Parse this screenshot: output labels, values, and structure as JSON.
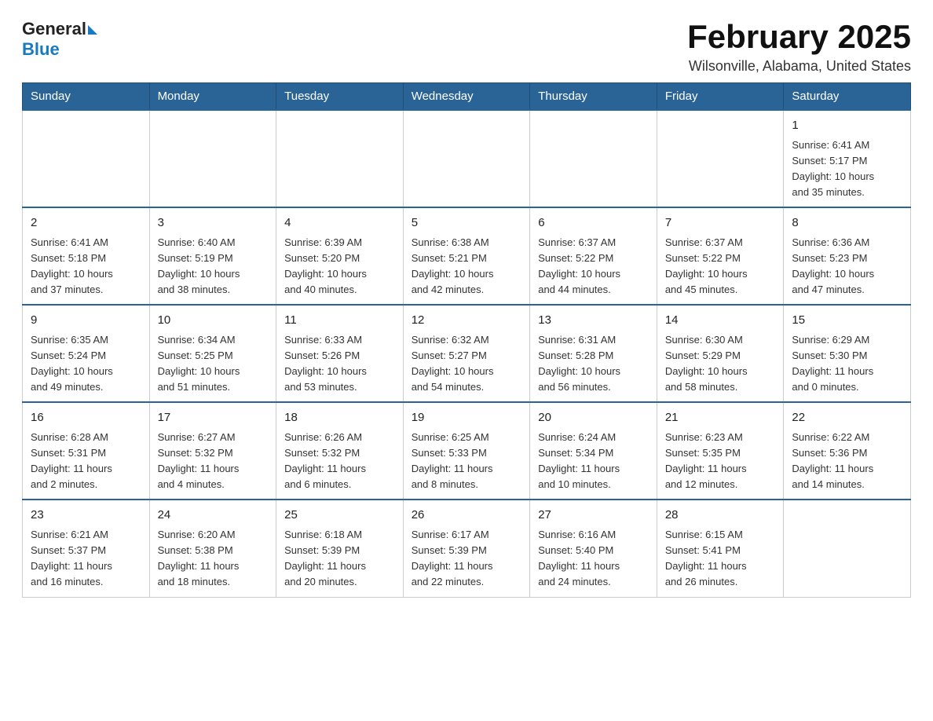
{
  "header": {
    "logo_general": "General",
    "logo_blue": "Blue",
    "month_year": "February 2025",
    "location": "Wilsonville, Alabama, United States"
  },
  "weekdays": [
    "Sunday",
    "Monday",
    "Tuesday",
    "Wednesday",
    "Thursday",
    "Friday",
    "Saturday"
  ],
  "weeks": [
    [
      {
        "day": "",
        "info": ""
      },
      {
        "day": "",
        "info": ""
      },
      {
        "day": "",
        "info": ""
      },
      {
        "day": "",
        "info": ""
      },
      {
        "day": "",
        "info": ""
      },
      {
        "day": "",
        "info": ""
      },
      {
        "day": "1",
        "info": "Sunrise: 6:41 AM\nSunset: 5:17 PM\nDaylight: 10 hours\nand 35 minutes."
      }
    ],
    [
      {
        "day": "2",
        "info": "Sunrise: 6:41 AM\nSunset: 5:18 PM\nDaylight: 10 hours\nand 37 minutes."
      },
      {
        "day": "3",
        "info": "Sunrise: 6:40 AM\nSunset: 5:19 PM\nDaylight: 10 hours\nand 38 minutes."
      },
      {
        "day": "4",
        "info": "Sunrise: 6:39 AM\nSunset: 5:20 PM\nDaylight: 10 hours\nand 40 minutes."
      },
      {
        "day": "5",
        "info": "Sunrise: 6:38 AM\nSunset: 5:21 PM\nDaylight: 10 hours\nand 42 minutes."
      },
      {
        "day": "6",
        "info": "Sunrise: 6:37 AM\nSunset: 5:22 PM\nDaylight: 10 hours\nand 44 minutes."
      },
      {
        "day": "7",
        "info": "Sunrise: 6:37 AM\nSunset: 5:22 PM\nDaylight: 10 hours\nand 45 minutes."
      },
      {
        "day": "8",
        "info": "Sunrise: 6:36 AM\nSunset: 5:23 PM\nDaylight: 10 hours\nand 47 minutes."
      }
    ],
    [
      {
        "day": "9",
        "info": "Sunrise: 6:35 AM\nSunset: 5:24 PM\nDaylight: 10 hours\nand 49 minutes."
      },
      {
        "day": "10",
        "info": "Sunrise: 6:34 AM\nSunset: 5:25 PM\nDaylight: 10 hours\nand 51 minutes."
      },
      {
        "day": "11",
        "info": "Sunrise: 6:33 AM\nSunset: 5:26 PM\nDaylight: 10 hours\nand 53 minutes."
      },
      {
        "day": "12",
        "info": "Sunrise: 6:32 AM\nSunset: 5:27 PM\nDaylight: 10 hours\nand 54 minutes."
      },
      {
        "day": "13",
        "info": "Sunrise: 6:31 AM\nSunset: 5:28 PM\nDaylight: 10 hours\nand 56 minutes."
      },
      {
        "day": "14",
        "info": "Sunrise: 6:30 AM\nSunset: 5:29 PM\nDaylight: 10 hours\nand 58 minutes."
      },
      {
        "day": "15",
        "info": "Sunrise: 6:29 AM\nSunset: 5:30 PM\nDaylight: 11 hours\nand 0 minutes."
      }
    ],
    [
      {
        "day": "16",
        "info": "Sunrise: 6:28 AM\nSunset: 5:31 PM\nDaylight: 11 hours\nand 2 minutes."
      },
      {
        "day": "17",
        "info": "Sunrise: 6:27 AM\nSunset: 5:32 PM\nDaylight: 11 hours\nand 4 minutes."
      },
      {
        "day": "18",
        "info": "Sunrise: 6:26 AM\nSunset: 5:32 PM\nDaylight: 11 hours\nand 6 minutes."
      },
      {
        "day": "19",
        "info": "Sunrise: 6:25 AM\nSunset: 5:33 PM\nDaylight: 11 hours\nand 8 minutes."
      },
      {
        "day": "20",
        "info": "Sunrise: 6:24 AM\nSunset: 5:34 PM\nDaylight: 11 hours\nand 10 minutes."
      },
      {
        "day": "21",
        "info": "Sunrise: 6:23 AM\nSunset: 5:35 PM\nDaylight: 11 hours\nand 12 minutes."
      },
      {
        "day": "22",
        "info": "Sunrise: 6:22 AM\nSunset: 5:36 PM\nDaylight: 11 hours\nand 14 minutes."
      }
    ],
    [
      {
        "day": "23",
        "info": "Sunrise: 6:21 AM\nSunset: 5:37 PM\nDaylight: 11 hours\nand 16 minutes."
      },
      {
        "day": "24",
        "info": "Sunrise: 6:20 AM\nSunset: 5:38 PM\nDaylight: 11 hours\nand 18 minutes."
      },
      {
        "day": "25",
        "info": "Sunrise: 6:18 AM\nSunset: 5:39 PM\nDaylight: 11 hours\nand 20 minutes."
      },
      {
        "day": "26",
        "info": "Sunrise: 6:17 AM\nSunset: 5:39 PM\nDaylight: 11 hours\nand 22 minutes."
      },
      {
        "day": "27",
        "info": "Sunrise: 6:16 AM\nSunset: 5:40 PM\nDaylight: 11 hours\nand 24 minutes."
      },
      {
        "day": "28",
        "info": "Sunrise: 6:15 AM\nSunset: 5:41 PM\nDaylight: 11 hours\nand 26 minutes."
      },
      {
        "day": "",
        "info": ""
      }
    ]
  ]
}
